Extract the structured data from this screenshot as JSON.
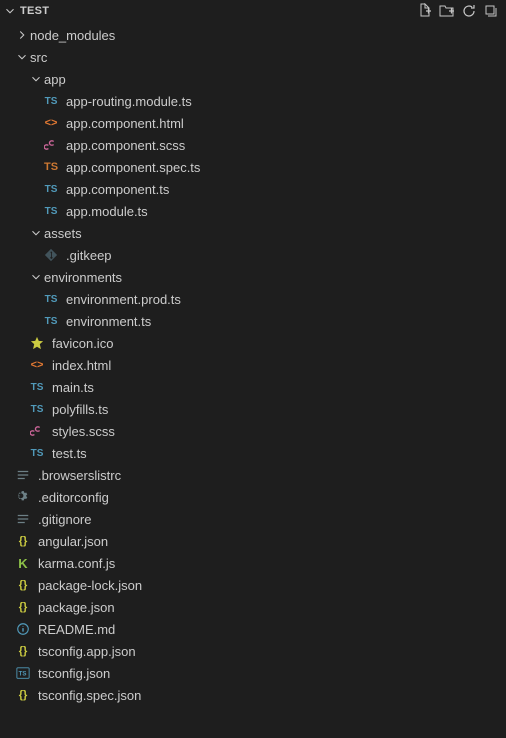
{
  "header": {
    "title": "TEST"
  },
  "tree": {
    "node_modules": "node_modules",
    "src": "src",
    "app": "app",
    "app_routing": "app-routing.module.ts",
    "app_component_html": "app.component.html",
    "app_component_scss": "app.component.scss",
    "app_component_spec": "app.component.spec.ts",
    "app_component_ts": "app.component.ts",
    "app_module": "app.module.ts",
    "assets": "assets",
    "gitkeep": ".gitkeep",
    "environments": "environments",
    "environment_prod": "environment.prod.ts",
    "environment_ts": "environment.ts",
    "favicon": "favicon.ico",
    "index_html": "index.html",
    "main_ts": "main.ts",
    "polyfills": "polyfills.ts",
    "styles_scss": "styles.scss",
    "test_ts": "test.ts",
    "browserslistrc": ".browserslistrc",
    "editorconfig": ".editorconfig",
    "gitignore": ".gitignore",
    "angular_json": "angular.json",
    "karma_conf": "karma.conf.js",
    "package_lock": "package-lock.json",
    "package_json": "package.json",
    "readme": "README.md",
    "tsconfig_app": "tsconfig.app.json",
    "tsconfig_json": "tsconfig.json",
    "tsconfig_spec": "tsconfig.spec.json"
  }
}
